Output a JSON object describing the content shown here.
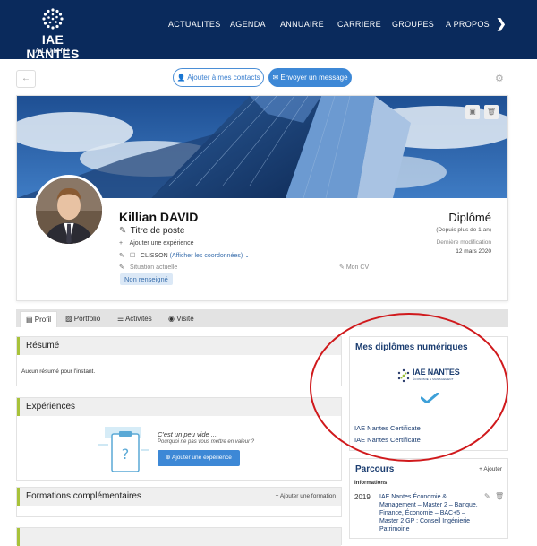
{
  "header": {
    "brand": "IAE NANTES",
    "brand_sub": "ALUMNI",
    "nav": [
      "ACTUALITES",
      "AGENDA",
      "ANNUAIRE",
      "CARRIERE",
      "GROUPES",
      "A PROPOS"
    ],
    "next_glyph": "❯"
  },
  "toolbar": {
    "back_glyph": "←",
    "add_contacts": "Ajouter à mes contacts",
    "send_message": "Envoyer un message",
    "settings_glyph": "⚙"
  },
  "profile": {
    "name": "Killian DAVID",
    "job_title": "Titre de poste",
    "add_experience": "Ajouter une expérience",
    "city": "CLISSON",
    "show_contact": "(Afficher les coordonnées)",
    "current_situation": "Situation actuelle",
    "situation_value": "Non renseigné",
    "my_cv": "Mon CV",
    "status": "Diplômé",
    "status_since": "(Depuis plus de 1 an)",
    "last_modified_label": "Dernière modification",
    "last_modified_date": "12 mars 2020"
  },
  "tabs": [
    {
      "label": "Profil",
      "icon": "profile-icon"
    },
    {
      "label": "Portfolio",
      "icon": "image-icon"
    },
    {
      "label": "Activités",
      "icon": "list-icon"
    },
    {
      "label": "Visite",
      "icon": "eye-icon"
    }
  ],
  "sections": {
    "resume_title": "Résumé",
    "resume_text": "Aucun résumé pour l'instant.",
    "experiences_title": "Expériences",
    "empty_title": "C'est un peu vide ...",
    "empty_sub": "Pourquoi ne pas vous mettre en valeur ?",
    "add_experience_btn": "Ajouter une expérience",
    "formations_title": "Formations complémentaires",
    "add_formation": "Ajouter une formation"
  },
  "diplomas": {
    "title": "Mes diplômes numériques",
    "logo_text": "IAE NANTES",
    "logo_sub": "ÉCONOMIE & MANAGEMENT",
    "certificates": [
      "IAE Nantes Certificate",
      "IAE Nantes Certificate"
    ]
  },
  "parcours": {
    "title": "Parcours",
    "add": "Ajouter",
    "subtitle": "Informations",
    "entries": [
      {
        "year": "2019",
        "text": "IAE Nantes Économie & Management – Master 2 – Banque, Finance, Économie – BAC+5 – Master 2 GP : Conseil Ingénierie Patrimoine"
      }
    ]
  },
  "colors": {
    "header_bg": "#0a2a5c",
    "accent_blue": "#3d88d6",
    "section_accent": "#a8c23a",
    "annotation_red": "#d0191c"
  }
}
